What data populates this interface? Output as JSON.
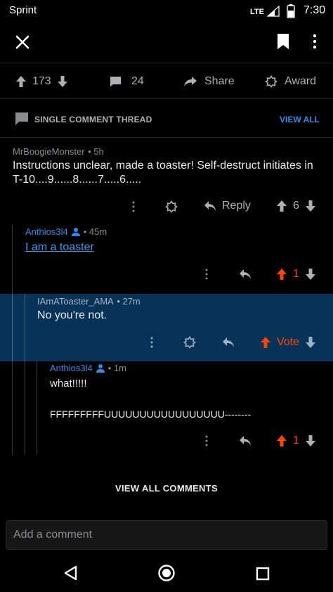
{
  "status": {
    "carrier": "Sprint",
    "network": "LTE",
    "time": "7:30"
  },
  "post_actions": {
    "upvotes": "173",
    "comments": "24",
    "share": "Share",
    "award": "Award"
  },
  "thread": {
    "title": "SINGLE COMMENT THREAD",
    "view_all": "VIEW ALL"
  },
  "comments": [
    {
      "author": "MrBoogieMonster",
      "age": "• 5h",
      "text": "Instructions unclear, made a toaster! Self-destruct initiates in T-10....9......8......7.....6.....",
      "reply": "Reply",
      "score": "6"
    },
    {
      "author": "Anthios3l4",
      "age": "• 45m",
      "text": "I am a toaster",
      "score": "1"
    },
    {
      "author": "IAmAToaster_AMA",
      "age": "• 27m",
      "text": "No you're not.",
      "vote": "Vote"
    },
    {
      "author": "Anthios3l4",
      "age": "• 1m",
      "line1": "what!!!!!",
      "line2": "FFFFFFFFFUUUUUUUUUUUUUUUUU--------",
      "score": "1"
    }
  ],
  "view_all_comments": "VIEW ALL COMMENTS",
  "comment_input": {
    "placeholder": "Add a comment"
  },
  "colors": {
    "upvote": "#ff4500",
    "accent_blue": "#2b8de6",
    "highlight": "#073358"
  }
}
